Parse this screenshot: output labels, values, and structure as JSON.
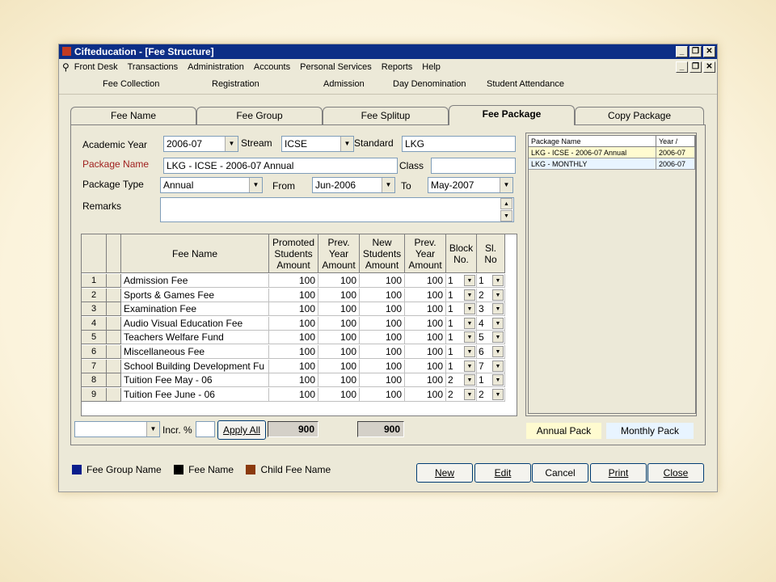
{
  "window": {
    "title": "Cifteducation - [Fee Structure]",
    "min": "_",
    "restore": "❐",
    "close": "✕"
  },
  "menu": [
    "Front Desk",
    "Transactions",
    "Administration",
    "Accounts",
    "Personal Services",
    "Reports",
    "Help"
  ],
  "toolbar": [
    "Fee Collection",
    "Registration",
    "Admission",
    "Day Denomination",
    "Student Attendance"
  ],
  "tabs": [
    "Fee Name",
    "Fee Group",
    "Fee Splitup",
    "Fee Package",
    "Copy Package"
  ],
  "form": {
    "academic_year_label": "Academic Year",
    "academic_year": "2006-07",
    "stream_label": "Stream",
    "stream": "ICSE",
    "standard_label": "Standard",
    "standard": "LKG",
    "package_name_label": "Package Name",
    "package_name": "LKG - ICSE - 2006-07 Annual",
    "class_label": "Class",
    "class": "",
    "package_type_label": "Package Type",
    "package_type": "Annual",
    "from_label": "From",
    "from": "Jun-2006",
    "to_label": "To",
    "to": "May-2007",
    "remarks_label": "Remarks",
    "remarks": ""
  },
  "grid": {
    "headers": {
      "fee_name": "Fee Name",
      "promoted": [
        "Promoted",
        "Students",
        "Amount"
      ],
      "prev1": [
        "Prev.",
        "Year",
        "Amount"
      ],
      "new": [
        "New",
        "Students",
        "Amount"
      ],
      "prev2": [
        "Prev.",
        "Year",
        "Amount"
      ],
      "block": [
        "Block",
        "No."
      ],
      "sl": [
        "Sl.",
        "No"
      ]
    },
    "rows": [
      {
        "n": "1",
        "name": "Admission Fee",
        "a": "100",
        "b": "100",
        "c": "100",
        "d": "100",
        "block": "1",
        "sl": "1"
      },
      {
        "n": "2",
        "name": "Sports & Games Fee",
        "a": "100",
        "b": "100",
        "c": "100",
        "d": "100",
        "block": "1",
        "sl": "2"
      },
      {
        "n": "3",
        "name": "Examination Fee",
        "a": "100",
        "b": "100",
        "c": "100",
        "d": "100",
        "block": "1",
        "sl": "3"
      },
      {
        "n": "4",
        "name": "Audio Visual Education Fee",
        "a": "100",
        "b": "100",
        "c": "100",
        "d": "100",
        "block": "1",
        "sl": "4"
      },
      {
        "n": "5",
        "name": "Teachers Welfare Fund",
        "a": "100",
        "b": "100",
        "c": "100",
        "d": "100",
        "block": "1",
        "sl": "5"
      },
      {
        "n": "6",
        "name": "Miscellaneous Fee",
        "a": "100",
        "b": "100",
        "c": "100",
        "d": "100",
        "block": "1",
        "sl": "6"
      },
      {
        "n": "7",
        "name": "School Building Development Fu",
        "a": "100",
        "b": "100",
        "c": "100",
        "d": "100",
        "block": "1",
        "sl": "7"
      },
      {
        "n": "8",
        "name": "Tuition Fee May - 06",
        "a": "100",
        "b": "100",
        "c": "100",
        "d": "100",
        "block": "2",
        "sl": "1"
      },
      {
        "n": "9",
        "name": "Tuition Fee June - 06",
        "a": "100",
        "b": "100",
        "c": "100",
        "d": "100",
        "block": "2",
        "sl": "2"
      }
    ]
  },
  "footer_bar": {
    "incr_label": "Incr. %",
    "incr_value": "",
    "apply_all": "Apply All",
    "total_promoted": "900",
    "total_new": "900"
  },
  "package_list": {
    "headers": [
      "Package Name",
      "Year /"
    ],
    "rows": [
      {
        "name": "LKG - ICSE - 2006-07 Annual",
        "year": "2006-07"
      },
      {
        "name": "LKG - MONTHLY",
        "year": "2006-07"
      }
    ],
    "annual_pack": "Annual Pack",
    "monthly_pack": "Monthly Pack"
  },
  "legend": [
    {
      "label": "Fee Group Name",
      "color": "#0a1e8c"
    },
    {
      "label": "Fee Name",
      "color": "#000000"
    },
    {
      "label": "Child Fee Name",
      "color": "#8b3a0e"
    }
  ],
  "actions": {
    "new": "New",
    "edit": "Edit",
    "cancel": "Cancel",
    "print": "Print",
    "close": "Close"
  },
  "colors": {
    "titlebar": "#0c2e86",
    "package_name_label": "#a0201e",
    "selected_pack_row": "#fffbd0",
    "monthly_row": "#e8f4ff"
  }
}
